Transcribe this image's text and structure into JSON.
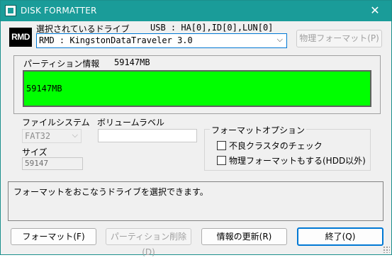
{
  "window": {
    "title": "DISK FORMATTER",
    "close_glyph": "✕"
  },
  "drive": {
    "icon_label": "RMD",
    "select_label": "選択されているドライブ",
    "interface_info": "USB : HA[0],ID[0],LUN[0]",
    "selected": "RMD : KingstonDataTraveler 3.0",
    "physical_format_button": "物理フォーマット(P)"
  },
  "partition": {
    "label": "パーティション情報",
    "total": "59147MB",
    "bar_text": "59147MB",
    "bar_color": "#00ff00"
  },
  "filesystem": {
    "label": "ファイルシステム",
    "value": "FAT32",
    "size_label": "サイズ",
    "size_value": "59147"
  },
  "volume": {
    "label": "ボリュームラベル",
    "value": ""
  },
  "options": {
    "label": "フォーマットオプション",
    "items": [
      {
        "label": "不良クラスタのチェック",
        "checked": false
      },
      {
        "label": "物理フォーマットもする(HDD以外)",
        "checked": false
      }
    ]
  },
  "status": {
    "message": "フォーマットをおこなうドライブを選択できます。"
  },
  "buttons": {
    "format": "フォーマット(F)",
    "delete_partition": "パーティション削除(D)",
    "refresh": "情報の更新(R)",
    "exit": "終了(Q)"
  },
  "colors": {
    "titlebar": "#1a9c99",
    "focus": "#0078d4"
  }
}
